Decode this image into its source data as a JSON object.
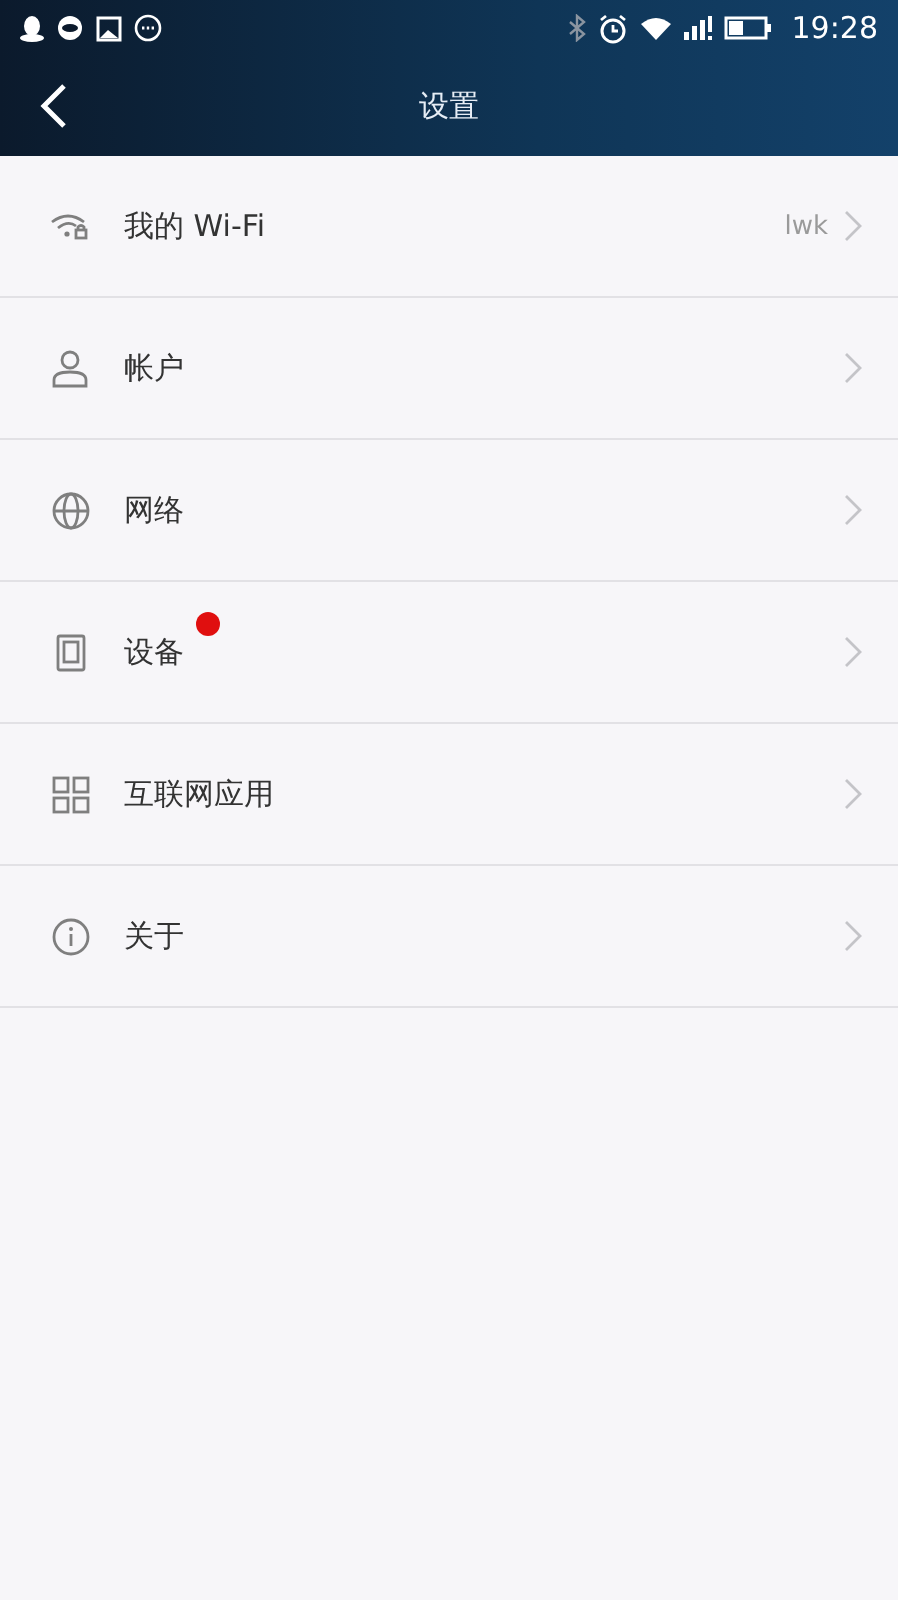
{
  "status_bar": {
    "time": "19:28"
  },
  "header": {
    "title": "设置"
  },
  "items": [
    {
      "kind": "wifi",
      "label": "我的 Wi-Fi",
      "value": "lwk",
      "badge": false
    },
    {
      "kind": "account",
      "label": "帐户",
      "badge": false
    },
    {
      "kind": "network",
      "label": "网络",
      "badge": false
    },
    {
      "kind": "device",
      "label": "设备",
      "badge": true
    },
    {
      "kind": "apps",
      "label": "互联网应用",
      "badge": false
    },
    {
      "kind": "info",
      "label": "关于",
      "badge": false
    }
  ]
}
